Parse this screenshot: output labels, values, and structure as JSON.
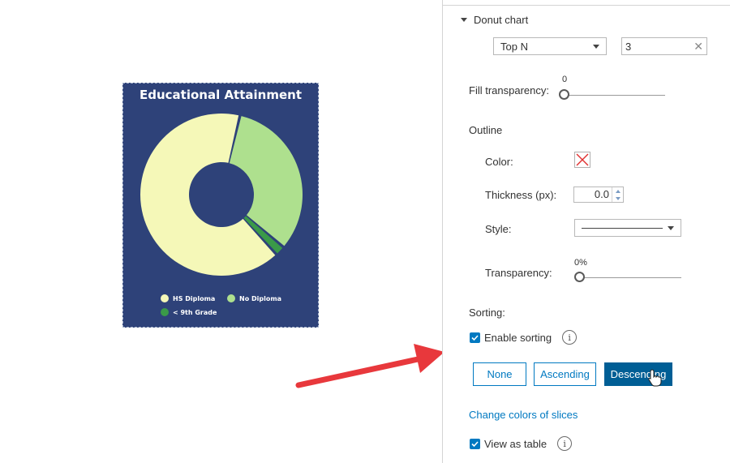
{
  "chart_card": {
    "title": "Educational Attainment",
    "background": "#2e4279",
    "legend": [
      {
        "label": "HS Diploma",
        "color": "#f5f8b8"
      },
      {
        "label": "No Diploma",
        "color": "#aee08e"
      },
      {
        "label": "< 9th Grade",
        "color": "#3a9a48"
      }
    ]
  },
  "chart_data": {
    "type": "pie",
    "title": "Educational Attainment",
    "categories": [
      "HS Diploma",
      "No Diploma",
      "< 9th Grade"
    ],
    "values": [
      65.5,
      32.5,
      2
    ],
    "colors": [
      "#f5f8b8",
      "#aee08e",
      "#3a9a48"
    ],
    "donut": true,
    "legend_position": "bottom"
  },
  "panel": {
    "section_title": "Donut chart",
    "topn": {
      "selected": "Top N",
      "value": "3"
    },
    "fill_transparency": {
      "label": "Fill transparency:",
      "value": "0",
      "percent": 0
    },
    "outline": {
      "title": "Outline",
      "color_label": "Color:",
      "thickness_label": "Thickness (px):",
      "thickness_value": "0.0",
      "style_label": "Style:",
      "transparency_label": "Transparency:",
      "transparency_value": "0%",
      "transparency_percent": 0
    },
    "sorting": {
      "label": "Sorting:",
      "enable_label": "Enable sorting",
      "enabled": true,
      "buttons": [
        "None",
        "Ascending",
        "Descending"
      ],
      "active": "Descending"
    },
    "change_colors_link": "Change colors of slices",
    "view_as_table_label": "View as table",
    "view_as_table": true,
    "accent": "#0079c1",
    "active_button_color": "#005e95"
  },
  "annotation": {
    "arrow_color": "#e8383c"
  }
}
